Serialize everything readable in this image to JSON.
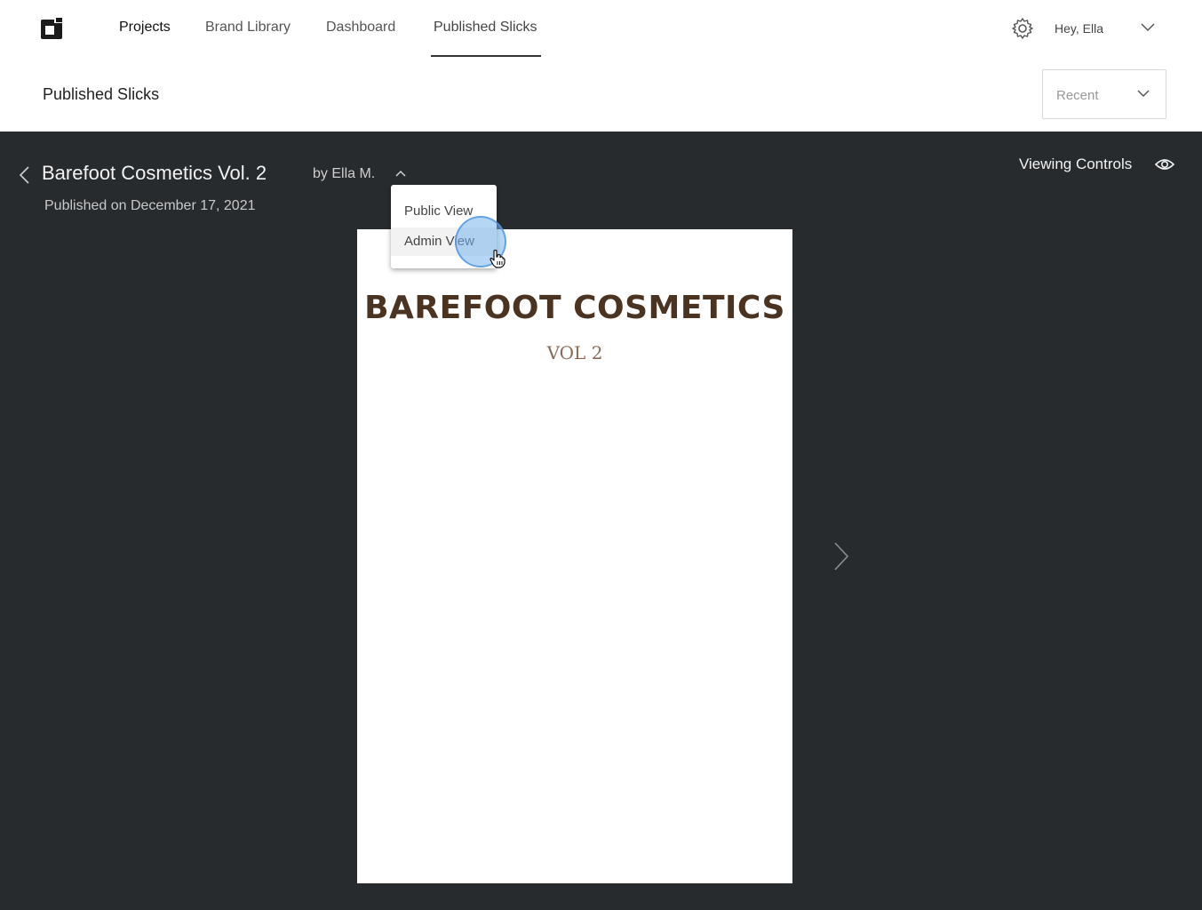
{
  "nav": {
    "logo_icon": "app-logo-icon",
    "links": [
      "Projects",
      "Brand Library",
      "Dashboard",
      "Published Slicks"
    ],
    "active": "Published Slicks",
    "greeting": "Hey, Ella"
  },
  "subheader": {
    "title": "Published Slicks",
    "sort_value": "Recent"
  },
  "viewer": {
    "doc_title": "Barefoot Cosmetics Vol. 2",
    "author": "by Ella M.",
    "published": "Published on December 17, 2021",
    "viewing_controls": "Viewing Controls",
    "cover_title": "BAREFOOT COSMETICS",
    "cover_subtitle": "VOL 2"
  },
  "view_menu": {
    "items": [
      "Public View",
      "Admin View"
    ],
    "hovered": "Admin View"
  },
  "colors": {
    "viewer_bg": "#282b2e",
    "cover_title": "#4a3320",
    "cover_subtitle": "#8a6a55"
  }
}
